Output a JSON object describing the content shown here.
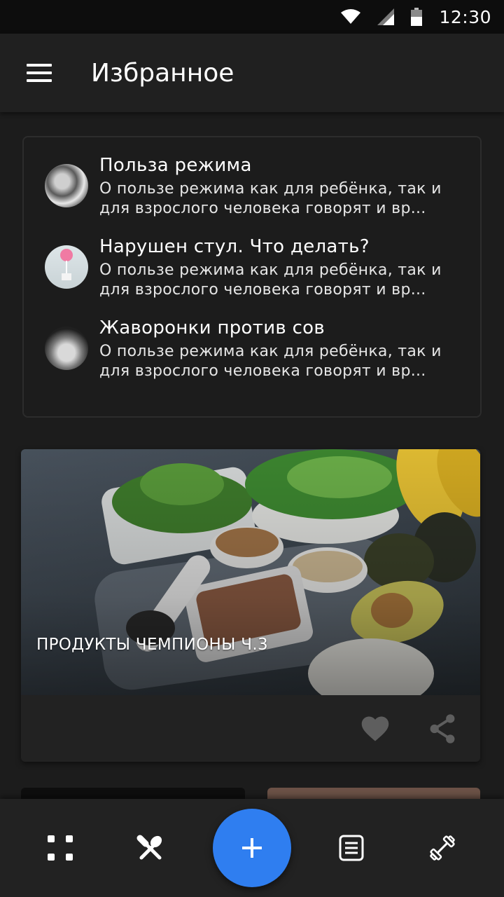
{
  "status_bar": {
    "time": "12:30",
    "icons": [
      "wifi-icon",
      "signal-icon",
      "battery-icon"
    ]
  },
  "app_bar": {
    "title": "Избранное",
    "menu_icon": "menu-icon"
  },
  "articles": [
    {
      "title": "Польза режима",
      "description": "О пользе режима как для ребёнка, так и для взрослого человека говорят и вр..."
    },
    {
      "title": "Нарушен стул. Что делать?",
      "description": "О пользе режима как для ребёнка, так и для взрослого человека говорят и вр..."
    },
    {
      "title": "Жаворонки против сов",
      "description": "О пользе режима как для ребёнка, так и для взрослого человека говорят и вр..."
    }
  ],
  "featured": {
    "caption": "ПРОДУКТЫ ЧЕМПИОНЫ Ч.3",
    "actions": [
      "heart-icon",
      "share-icon"
    ]
  },
  "bottom_nav": {
    "items": [
      "grid-icon",
      "food-icon",
      "add-icon",
      "notes-icon",
      "dumbbell-icon"
    ]
  },
  "colors": {
    "background": "#1c1c1c",
    "app_bar": "#202020",
    "accent": "#2f7ef0",
    "icon_muted": "#5e5e5e"
  }
}
